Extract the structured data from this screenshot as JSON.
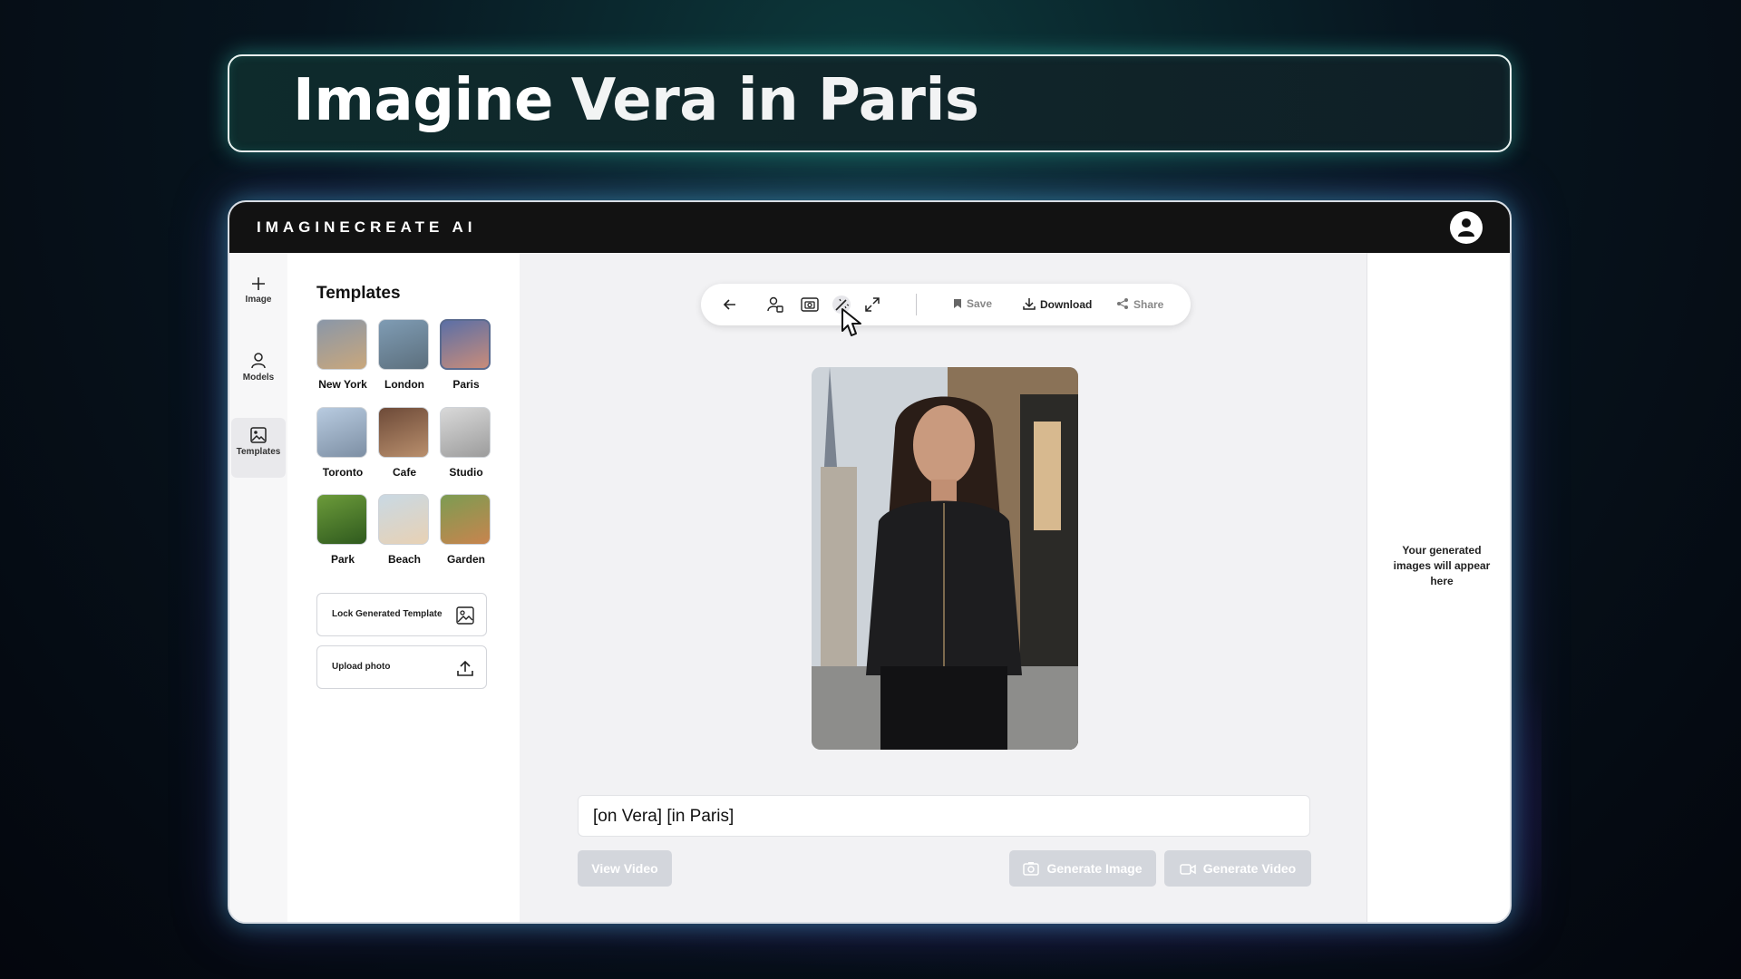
{
  "headline": {
    "part1": "Imagine",
    "part2": "Vera in Paris"
  },
  "app": {
    "brand": "IMAGINECREATE AI"
  },
  "rail": [
    {
      "label": "Image",
      "icon": "plus-icon"
    },
    {
      "label": "Models",
      "icon": "person-icon"
    },
    {
      "label": "Templates",
      "icon": "image-icon",
      "active": true
    }
  ],
  "templates": {
    "title": "Templates",
    "items": [
      {
        "label": "New York",
        "colors": [
          "#8a97a8",
          "#c9a77c"
        ]
      },
      {
        "label": "London",
        "colors": [
          "#7f9cb4",
          "#5c6f7d"
        ]
      },
      {
        "label": "Paris",
        "colors": [
          "#5b6fa6",
          "#c98c7a"
        ],
        "selected": true
      },
      {
        "label": "Toronto",
        "colors": [
          "#b8cbe0",
          "#7d8fa4"
        ]
      },
      {
        "label": "Cafe",
        "colors": [
          "#6d4a38",
          "#b98f6d"
        ]
      },
      {
        "label": "Studio",
        "colors": [
          "#d9d9d9",
          "#9c9c9c"
        ]
      },
      {
        "label": "Park",
        "colors": [
          "#6c9b3a",
          "#2f5a1e"
        ]
      },
      {
        "label": "Beach",
        "colors": [
          "#c9d9e4",
          "#e8d1b4"
        ]
      },
      {
        "label": "Garden",
        "colors": [
          "#7c9c52",
          "#c8844e"
        ]
      }
    ],
    "lock_label": "Lock Generated Template",
    "upload_label": "Upload photo"
  },
  "toolbar": {
    "icons": [
      "back-arrow-icon",
      "person-swap-icon",
      "camera-frame-icon",
      "magic-wand-icon",
      "expand-icon"
    ],
    "save_label": "Save",
    "download_label": "Download",
    "share_label": "Share"
  },
  "prompt": {
    "value": "[on Vera] [in Paris]"
  },
  "buttons": {
    "view_video": "View Video",
    "generate_image": "Generate Image",
    "generate_video": "Generate Video"
  },
  "right_panel": {
    "empty_message": "Your generated images will appear here"
  }
}
